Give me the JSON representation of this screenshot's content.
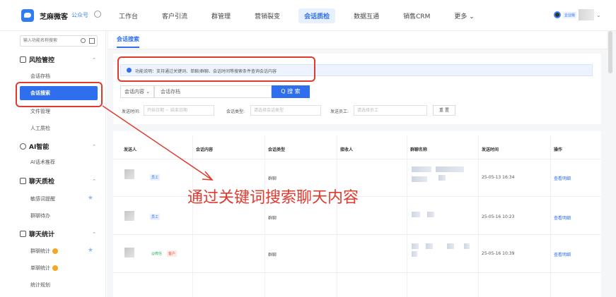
{
  "topbar": {
    "brand": "芝麻微客",
    "account": "公众号",
    "nav": [
      "工作台",
      "客户引流",
      "群管理",
      "营销裂变",
      "会话质检",
      "数据互通",
      "销售CRM",
      "更多 ⌄"
    ],
    "nav_active_index": 4,
    "user_tag": "企业版"
  },
  "sidebar": {
    "search_placeholder": "输入功能名称搜索",
    "groups": [
      {
        "label": "风险管控",
        "items": [
          "会话存档",
          "会话搜索",
          "文件管理",
          "人工质检"
        ]
      },
      {
        "label": "AI智能",
        "items": [
          "AI话术推荐"
        ]
      },
      {
        "label": "聊天质检",
        "items": [
          "敏感词提醒",
          "群聊待办"
        ]
      },
      {
        "label": "聊天统计",
        "items": [
          "群聊统计",
          "单聊统计",
          "统计规划"
        ]
      }
    ],
    "active_item": "会话搜索",
    "chevron": "⌃",
    "star": "★"
  },
  "main": {
    "tab": "会话搜索",
    "notice": "功能说明：支持通过关键词、单聊/群聊、会话时间等搜索条件查询会话内容",
    "search_type": "会话内容 ⌄",
    "keyword_value": "会话存档",
    "search_button": "Q 搜 索",
    "filters": {
      "send_time_label": "发送时间:",
      "send_time_value": "开始日期  ~  结束日期",
      "session_type_label": "会话类型:",
      "session_type_placeholder": "请选择会话类型",
      "sender_label": "发送员工:",
      "sender_placeholder": "请选择员工",
      "reset": "重 置"
    },
    "columns": [
      "发送人",
      "会话内容",
      "会话类型",
      "接收人",
      "群聊名称",
      "发送时间",
      "操作"
    ],
    "rows": [
      {
        "tags": [
          "员工"
        ],
        "type": "群聊",
        "time": "25-05-13 16:34",
        "action": "查看明细"
      },
      {
        "tags": [
          "员工"
        ],
        "type": "群聊",
        "time": "25-05-16 10:23",
        "action": "查看明细"
      },
      {
        "tags": [
          "@微信",
          "客户"
        ],
        "type": "群聊",
        "time": "25-05-16 10:39",
        "action": "查看明细"
      }
    ]
  },
  "annotation": {
    "text": "通过关键词搜索聊天内容",
    "color": "#e03a2f"
  },
  "colors": {
    "primary": "#2f6fed",
    "annotation_red": "#e03a2f"
  }
}
